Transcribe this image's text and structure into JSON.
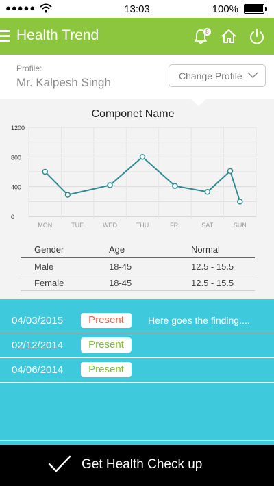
{
  "status_bar": {
    "carrier": "●●●●●",
    "time": "13:03",
    "battery": "100%"
  },
  "header": {
    "title": "Health Trend",
    "notification_count": "8"
  },
  "profile": {
    "label": "Profile:",
    "name": "Mr. Kalpesh Singh",
    "change_button": "Change Profile"
  },
  "chart_data": {
    "type": "line",
    "title": "Componet Name",
    "categories": [
      "MON",
      "TUE",
      "WED",
      "THU",
      "FRI",
      "SAT",
      "SUN"
    ],
    "x": [
      0.5,
      1.2,
      2.5,
      3.5,
      4.5,
      5.5,
      6.2,
      6.5
    ],
    "values": [
      600,
      290,
      420,
      800,
      410,
      330,
      610,
      200
    ],
    "yticks": [
      "1200",
      "800",
      "400",
      "0"
    ],
    "ylim": [
      0,
      1200
    ],
    "grid": true,
    "line_color": "#2f8a8f"
  },
  "range_table": {
    "headers": [
      "Gender",
      "Age",
      "Normal"
    ],
    "rows": [
      [
        "Male",
        "18-45",
        "12.5 - 15.5"
      ],
      [
        "Female",
        "18-45",
        "12.5 - 15.5"
      ]
    ]
  },
  "results": [
    {
      "date": "04/03/2015",
      "status": "Present",
      "status_color": "#e8664a",
      "finding": "Here goes the finding...."
    },
    {
      "date": "02/12/2014",
      "status": "Present",
      "status_color": "#7ec23a",
      "finding": ""
    },
    {
      "date": "04/06/2014",
      "status": "Present",
      "status_color": "#7ec23a",
      "finding": ""
    }
  ],
  "footer": {
    "label": "Get Health Check up"
  },
  "colors": {
    "header": "#8cc63f",
    "results_bg": "#3ec9dd",
    "footer": "#000000"
  }
}
